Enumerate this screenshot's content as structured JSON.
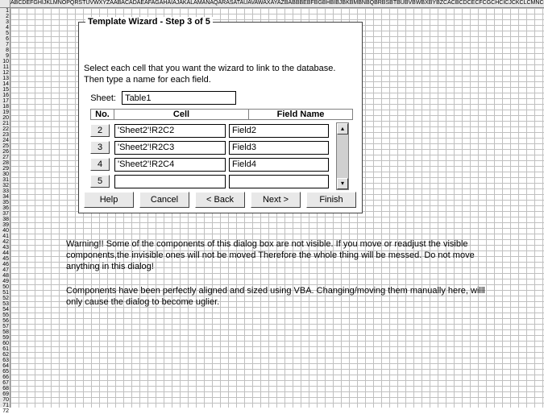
{
  "columns": "ABCDEFGHIJKLMNOPQRSTUVWXYZAABACADAEAFAGAHAIAJAKALAMANAQARASATAUAVAWAXAYAZBABBBEBFBGBHBIBJBKBMBNBQBRBSBTBUBVBWBXBYBZCACBCDCECFCGCHCICJCKCLCMNCOCP",
  "row_count": 72,
  "dialog": {
    "title": "Template Wizard - Step 3 of 5",
    "instruction": "Select each cell that you want the wizard to link to the database. Then type a name for each field.",
    "sheet_label": "Sheet:",
    "sheet_value": "Table1",
    "headers": {
      "no": "No.",
      "cell": "Cell",
      "field": "Field Name"
    },
    "rows": [
      {
        "no": "2",
        "cell": "'Sheet2'!R2C2",
        "field": "Field2"
      },
      {
        "no": "3",
        "cell": "'Sheet2'!R2C3",
        "field": "Field3"
      },
      {
        "no": "4",
        "cell": "'Sheet2'!R2C4",
        "field": "Field4"
      },
      {
        "no": "5",
        "cell": "",
        "field": ""
      }
    ],
    "buttons": {
      "help": "Help",
      "cancel": "Cancel",
      "back": "< Back",
      "next": "Next >",
      "finish": "Finish"
    }
  },
  "warning1": "Warning!! Some of the components of this dialog box are not visible. If you move or readjust the visible components,the invisible ones will not be moved\nTherefore the whole thing will be messed. Do not move anything in this dialog!",
  "warning2": "Components have been perfectly aligned and sized using VBA. Changing/moving them manually here, willl only cause the dialog to become uglier."
}
